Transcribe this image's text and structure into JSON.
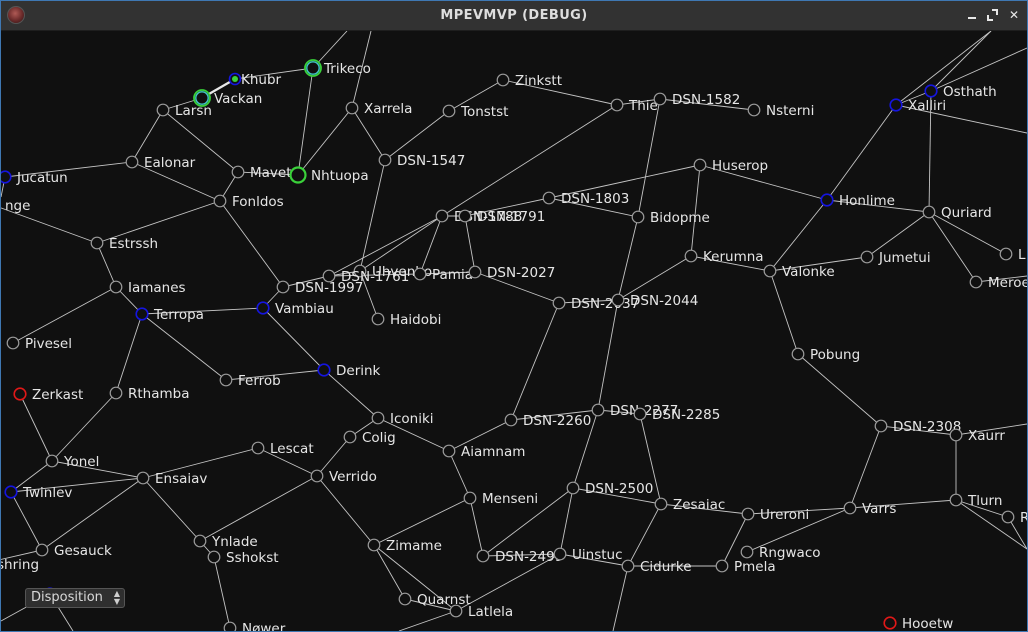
{
  "window": {
    "title": "MPEVMVP (DEBUG)"
  },
  "controls": {
    "disposition": {
      "selected": "Disposition"
    }
  },
  "colors": {
    "background": "#101010",
    "node": "#9a9a9a",
    "edge": "#c4c4c4",
    "neutral": "#9a9a9a",
    "blue": "#1515e0",
    "red": "#e01818",
    "green": "#3ad13a",
    "cyan": "#40c8c8"
  },
  "systems": [
    {
      "id": "khubr",
      "label": "Khubr",
      "status": "player-fleet"
    },
    {
      "id": "trikeco",
      "label": "Trikeco",
      "status": "green-cyan"
    },
    {
      "id": "vackan",
      "label": "Vackan",
      "status": "green-cyan"
    },
    {
      "id": "larsn",
      "label": "Larsn",
      "status": "neutral"
    },
    {
      "id": "xarrela",
      "label": "Xarrela",
      "status": "neutral"
    },
    {
      "id": "zinkstt",
      "label": "Zinkstt",
      "status": "neutral"
    },
    {
      "id": "tonstst",
      "label": "Tonstst",
      "status": "neutral"
    },
    {
      "id": "thie",
      "label": "Thie",
      "status": "neutral"
    },
    {
      "id": "dsn1582",
      "label": "DSN-1582",
      "status": "neutral"
    },
    {
      "id": "nsterni",
      "label": "Nsterni",
      "status": "neutral"
    },
    {
      "id": "osthath",
      "label": "Osthath",
      "status": "blue"
    },
    {
      "id": "xalliri",
      "label": "Xalliri",
      "status": "blue"
    },
    {
      "id": "jucatun",
      "label": "Jucatun",
      "status": "blue"
    },
    {
      "id": "ealonar",
      "label": "Ealonar",
      "status": "neutral"
    },
    {
      "id": "mavet",
      "label": "Mavet",
      "status": "neutral"
    },
    {
      "id": "nhtuopa",
      "label": "Nhtuopa",
      "status": "green"
    },
    {
      "id": "dsn1547",
      "label": "DSN-1547",
      "status": "neutral"
    },
    {
      "id": "huserop",
      "label": "Huserop",
      "status": "neutral"
    },
    {
      "id": "inge",
      "label": "nge",
      "status": "neutral"
    },
    {
      "id": "fonldos",
      "label": "Fonldos",
      "status": "neutral"
    },
    {
      "id": "dsn1803",
      "label": "DSN-1803",
      "status": "neutral"
    },
    {
      "id": "honlime",
      "label": "Honlime",
      "status": "blue"
    },
    {
      "id": "quriard",
      "label": "Quriard",
      "status": "neutral"
    },
    {
      "id": "dsn1788",
      "label": "DSN-1788",
      "status": "neutral"
    },
    {
      "id": "dsn1791",
      "label": "DSN-1791",
      "status": "neutral"
    },
    {
      "id": "bidopme",
      "label": "Bidopme",
      "status": "neutral"
    },
    {
      "id": "estrssh",
      "label": "Estrssh",
      "status": "neutral"
    },
    {
      "id": "kerumna",
      "label": "Kerumna",
      "status": "neutral"
    },
    {
      "id": "jumetui",
      "label": "Jumetui",
      "status": "neutral"
    },
    {
      "id": "ledge",
      "label": "L",
      "status": "neutral"
    },
    {
      "id": "valonke",
      "label": "Valonke",
      "status": "neutral"
    },
    {
      "id": "uhvenbo",
      "label": "Uhvenbo",
      "status": "neutral"
    },
    {
      "id": "dsn1761",
      "label": "DSN-1761",
      "status": "neutral"
    },
    {
      "id": "pamia",
      "label": "Pamia",
      "status": "neutral"
    },
    {
      "id": "dsn2027",
      "label": "DSN-2027",
      "status": "neutral"
    },
    {
      "id": "meroe",
      "label": "Meroe",
      "status": "neutral"
    },
    {
      "id": "iamanes",
      "label": "Iamanes",
      "status": "neutral"
    },
    {
      "id": "dsn1997",
      "label": "DSN-1997",
      "status": "neutral"
    },
    {
      "id": "dsn2037",
      "label": "DSN-2037",
      "status": "neutral"
    },
    {
      "id": "dsn2044",
      "label": "DSN-2044",
      "status": "neutral"
    },
    {
      "id": "terropa",
      "label": "Terropa",
      "status": "blue"
    },
    {
      "id": "vambiau",
      "label": "Vambiau",
      "status": "blue"
    },
    {
      "id": "haidobi",
      "label": "Haidobi",
      "status": "neutral"
    },
    {
      "id": "pivesel",
      "label": "Pivesel",
      "status": "neutral"
    },
    {
      "id": "pobung",
      "label": "Pobung",
      "status": "neutral"
    },
    {
      "id": "derink",
      "label": "Derink",
      "status": "blue"
    },
    {
      "id": "ferrob",
      "label": "Ferrob",
      "status": "neutral"
    },
    {
      "id": "zerkast",
      "label": "Zerkast",
      "status": "red"
    },
    {
      "id": "rthamba",
      "label": "Rthamba",
      "status": "neutral"
    },
    {
      "id": "iconiki",
      "label": "Iconiki",
      "status": "neutral"
    },
    {
      "id": "dsn2260",
      "label": "DSN-2260",
      "status": "neutral"
    },
    {
      "id": "dsn2277",
      "label": "DSN-2277",
      "status": "neutral"
    },
    {
      "id": "dsn2285",
      "label": "DSN-2285",
      "status": "neutral"
    },
    {
      "id": "dsn2308",
      "label": "DSN-2308",
      "status": "neutral"
    },
    {
      "id": "xaurr",
      "label": "Xaurr",
      "status": "neutral"
    },
    {
      "id": "colig",
      "label": "Colig",
      "status": "neutral"
    },
    {
      "id": "lescat",
      "label": "Lescat",
      "status": "neutral"
    },
    {
      "id": "aiamnam",
      "label": "Aiamnam",
      "status": "neutral"
    },
    {
      "id": "yonel",
      "label": "Yonel",
      "status": "neutral"
    },
    {
      "id": "verrido",
      "label": "Verrido",
      "status": "neutral"
    },
    {
      "id": "ensaiav",
      "label": "Ensaiav",
      "status": "neutral"
    },
    {
      "id": "twinlev",
      "label": "Twinlev",
      "status": "blue"
    },
    {
      "id": "dsn2500",
      "label": "DSN-2500",
      "status": "neutral"
    },
    {
      "id": "menseni",
      "label": "Menseni",
      "status": "neutral"
    },
    {
      "id": "zesaiac",
      "label": "Zesaiac",
      "status": "neutral"
    },
    {
      "id": "tlurn",
      "label": "Tlurn",
      "status": "neutral"
    },
    {
      "id": "varrs",
      "label": "Varrs",
      "status": "neutral"
    },
    {
      "id": "ureroni",
      "label": "Ureroni",
      "status": "neutral"
    },
    {
      "id": "redge",
      "label": "R",
      "status": "neutral"
    },
    {
      "id": "ynlade",
      "label": "Ynlade",
      "status": "neutral"
    },
    {
      "id": "sshokst",
      "label": "Sshokst",
      "status": "neutral"
    },
    {
      "id": "zimame",
      "label": "Zimame",
      "status": "neutral"
    },
    {
      "id": "gesauck",
      "label": "Gesauck",
      "status": "neutral"
    },
    {
      "id": "dsn2499",
      "label": "DSN-2499",
      "status": "neutral"
    },
    {
      "id": "uinstuc",
      "label": "Uinstuc",
      "status": "neutral"
    },
    {
      "id": "rngwaco",
      "label": "Rngwaco",
      "status": "neutral"
    },
    {
      "id": "cidurke",
      "label": "Cidurke",
      "status": "neutral"
    },
    {
      "id": "pmela",
      "label": "Pmela",
      "status": "neutral"
    },
    {
      "id": "shring",
      "label": "shring",
      "status": "neutral"
    },
    {
      "id": "dispnode",
      "label": "",
      "status": "blue"
    },
    {
      "id": "quarnst",
      "label": "Quarnst",
      "status": "neutral"
    },
    {
      "id": "latlela",
      "label": "Latlela",
      "status": "neutral"
    },
    {
      "id": "nower",
      "label": "Nøwer",
      "status": "neutral"
    },
    {
      "id": "hooetw",
      "label": "Hooetw",
      "status": "red"
    }
  ],
  "lanes": [
    [
      "khubr",
      "vackan"
    ],
    [
      "vackan",
      "larsn"
    ],
    [
      "larsn",
      "ealonar"
    ],
    [
      "larsn",
      "mavet"
    ],
    [
      "trikeco",
      "khubr"
    ],
    [
      "trikeco",
      "nhtuopa"
    ],
    [
      "xarrela",
      "nhtuopa"
    ],
    [
      "mavet",
      "nhtuopa"
    ],
    [
      "mavet",
      "fonldos"
    ],
    [
      "ealonar",
      "jucatun"
    ],
    [
      "ealonar",
      "fonldos"
    ],
    [
      "fonldos",
      "estrssh"
    ],
    [
      "fonldos",
      "dsn1997"
    ],
    [
      "estrssh",
      "inge"
    ],
    [
      "estrssh",
      "iamanes"
    ],
    [
      "iamanes",
      "pivesel"
    ],
    [
      "iamanes",
      "terropa"
    ],
    [
      "tonstst",
      "zinkstt"
    ],
    [
      "tonstst",
      "dsn1547"
    ],
    [
      "dsn1547",
      "xarrela"
    ],
    [
      "dsn1547",
      "uhvenbo"
    ],
    [
      "thie",
      "zinkstt"
    ],
    [
      "thie",
      "dsn1788"
    ],
    [
      "thie",
      "dsn1582"
    ],
    [
      "dsn1582",
      "nsterni"
    ],
    [
      "dsn1582",
      "bidopme"
    ],
    [
      "huserop",
      "dsn1803"
    ],
    [
      "huserop",
      "honlime"
    ],
    [
      "huserop",
      "kerumna"
    ],
    [
      "dsn1803",
      "dsn1791"
    ],
    [
      "dsn1803",
      "bidopme"
    ],
    [
      "honlime",
      "xalliri"
    ],
    [
      "honlime",
      "quriard"
    ],
    [
      "honlime",
      "valonke"
    ],
    [
      "xalliri",
      "osthath"
    ],
    [
      "quriard",
      "osthath"
    ],
    [
      "quriard",
      "jumetui"
    ],
    [
      "quriard",
      "ledge"
    ],
    [
      "jumetui",
      "valonke"
    ],
    [
      "kerumna",
      "valonke"
    ],
    [
      "kerumna",
      "dsn2044"
    ],
    [
      "valonke",
      "pobung"
    ],
    [
      "dsn1788",
      "uhvenbo"
    ],
    [
      "dsn1788",
      "pamia"
    ],
    [
      "dsn1788",
      "dsn1791"
    ],
    [
      "dsn1791",
      "dsn2027"
    ],
    [
      "uhvenbo",
      "dsn1761"
    ],
    [
      "uhvenbo",
      "haidobi"
    ],
    [
      "dsn1761",
      "dsn1997"
    ],
    [
      "dsn1761",
      "pamia"
    ],
    [
      "pamia",
      "dsn2027"
    ],
    [
      "dsn2027",
      "dsn2037"
    ],
    [
      "dsn2037",
      "dsn2044"
    ],
    [
      "dsn2037",
      "dsn2260"
    ],
    [
      "dsn2044",
      "bidopme"
    ],
    [
      "dsn2044",
      "dsn2277"
    ],
    [
      "terropa",
      "vambiau"
    ],
    [
      "terropa",
      "ferrob"
    ],
    [
      "terropa",
      "rthamba"
    ],
    [
      "vambiau",
      "derink"
    ],
    [
      "vambiau",
      "dsn1997"
    ],
    [
      "ferrob",
      "derink"
    ],
    [
      "derink",
      "iconiki"
    ],
    [
      "iconiki",
      "colig"
    ],
    [
      "iconiki",
      "aiamnam"
    ],
    [
      "colig",
      "verrido"
    ],
    [
      "lescat",
      "ensaiav"
    ],
    [
      "lescat",
      "verrido"
    ],
    [
      "verrido",
      "ynlade"
    ],
    [
      "verrido",
      "zimame"
    ],
    [
      "aiamnam",
      "dsn2260"
    ],
    [
      "aiamnam",
      "menseni"
    ],
    [
      "dsn2260",
      "dsn2277"
    ],
    [
      "dsn2277",
      "dsn2285"
    ],
    [
      "dsn2277",
      "dsn2500"
    ],
    [
      "dsn2285",
      "zesaiac"
    ],
    [
      "dsn2500",
      "zesaiac"
    ],
    [
      "dsn2500",
      "uinstuc"
    ],
    [
      "dsn2500",
      "dsn2499"
    ],
    [
      "menseni",
      "zimame"
    ],
    [
      "menseni",
      "dsn2499"
    ],
    [
      "zesaiac",
      "ureroni"
    ],
    [
      "zesaiac",
      "cidurke"
    ],
    [
      "ureroni",
      "varrs"
    ],
    [
      "varrs",
      "dsn2308"
    ],
    [
      "varrs",
      "tlurn"
    ],
    [
      "varrs",
      "rngwaco"
    ],
    [
      "dsn2308",
      "pobung"
    ],
    [
      "dsn2308",
      "xaurr"
    ],
    [
      "xaurr",
      "tlurn"
    ],
    [
      "tlurn",
      "redge"
    ],
    [
      "rthamba",
      "yonel"
    ],
    [
      "yonel",
      "ensaiav"
    ],
    [
      "yonel",
      "twinlev"
    ],
    [
      "zerkast",
      "yonel"
    ],
    [
      "ensaiav",
      "twinlev"
    ],
    [
      "ensaiav",
      "ynlade"
    ],
    [
      "ensaiav",
      "gesauck"
    ],
    [
      "ynlade",
      "sshokst"
    ],
    [
      "gesauck",
      "shring"
    ],
    [
      "zimame",
      "quarnst"
    ],
    [
      "zimame",
      "latlela"
    ],
    [
      "quarnst",
      "latlela"
    ],
    [
      "latlela",
      "uinstuc"
    ],
    [
      "uinstuc",
      "cidurke"
    ],
    [
      "cidurke",
      "pmela"
    ],
    [
      "pmela",
      "ureroni"
    ],
    [
      "dsn2499",
      "uinstuc"
    ],
    [
      "sshokst",
      "nower"
    ]
  ],
  "labels": {
    "route_note": ""
  }
}
